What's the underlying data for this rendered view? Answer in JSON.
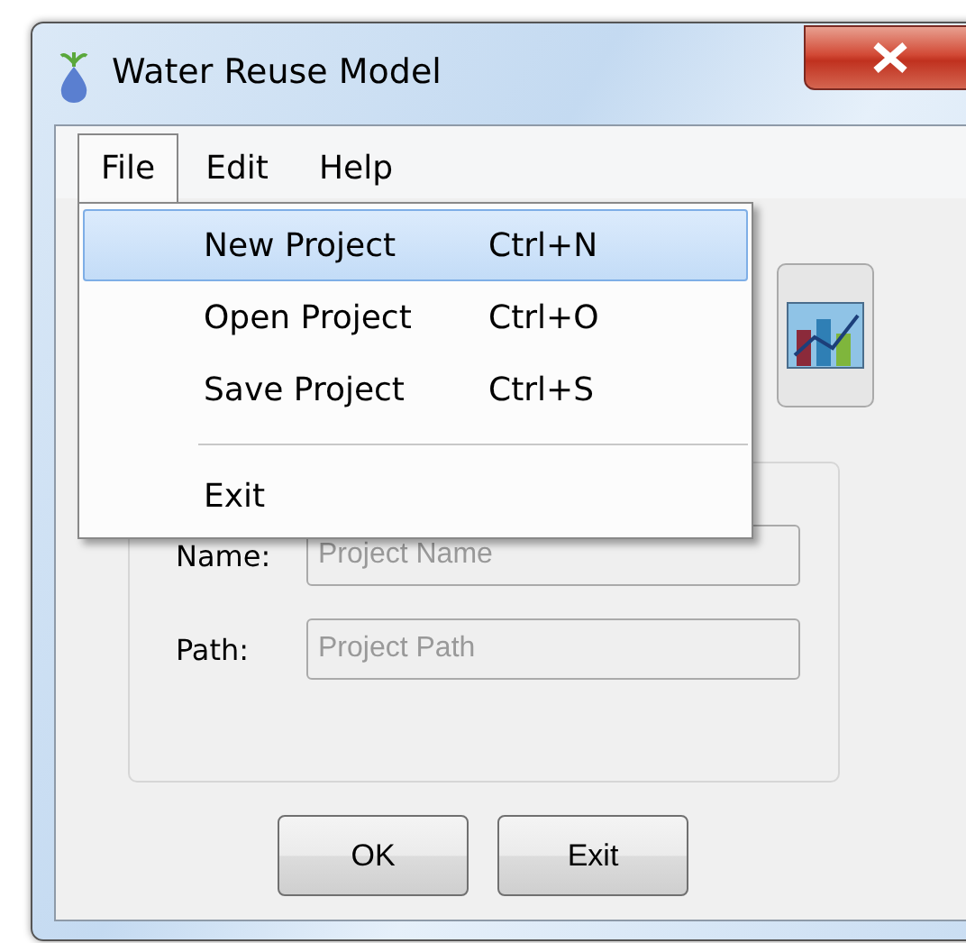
{
  "window": {
    "title": "Water Reuse Model"
  },
  "menu_bar": [
    {
      "label": "File",
      "selected": true
    },
    {
      "label": "Edit",
      "selected": false
    },
    {
      "label": "Help",
      "selected": false
    }
  ],
  "file_menu": {
    "items": [
      {
        "kind": "item",
        "label": "New Project",
        "shortcut": "Ctrl+N",
        "selected": true
      },
      {
        "kind": "item",
        "label": "Open Project",
        "shortcut": "Ctrl+O",
        "selected": false
      },
      {
        "kind": "item",
        "label": "Save Project",
        "shortcut": "Ctrl+S",
        "selected": false
      },
      {
        "kind": "separator"
      },
      {
        "kind": "item",
        "label": "Exit",
        "selected": false
      }
    ]
  },
  "project": {
    "fields": [
      {
        "label": "Name:",
        "placeholder": "Project Name"
      },
      {
        "label": "Path:",
        "placeholder": "Project Path"
      }
    ]
  },
  "buttons": [
    "OK",
    "Exit"
  ]
}
